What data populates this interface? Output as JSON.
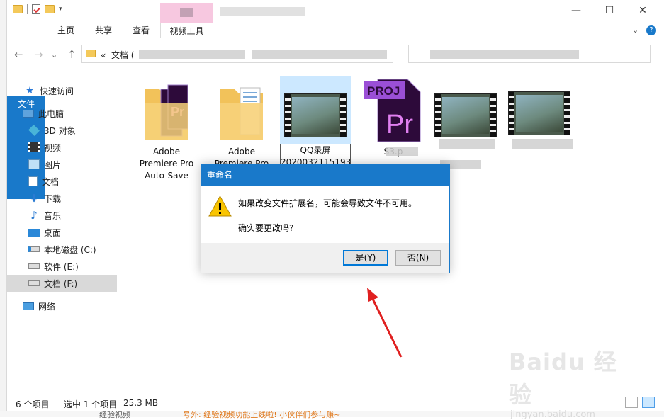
{
  "titlebar": {
    "context_tab_color": "#f7c8e0",
    "min_icon": "minimize-icon",
    "max_icon": "maximize-icon",
    "close_icon": "close-icon"
  },
  "ribbon": {
    "tabs": [
      "文件",
      "主页",
      "共享",
      "查看",
      "视频工具"
    ],
    "accent": "#1979ca"
  },
  "address": {
    "prefix": "«",
    "crumb": "文档 ("
  },
  "navpane": {
    "items": [
      {
        "label": "快速访问",
        "icon": "star-icon"
      },
      {
        "label": "此电脑",
        "icon": "computer-icon"
      },
      {
        "label": "3D 对象",
        "icon": "cube-icon"
      },
      {
        "label": "视频",
        "icon": "film-icon"
      },
      {
        "label": "图片",
        "icon": "picture-icon"
      },
      {
        "label": "文档",
        "icon": "document-icon"
      },
      {
        "label": "下载",
        "icon": "download-icon"
      },
      {
        "label": "音乐",
        "icon": "music-icon"
      },
      {
        "label": "桌面",
        "icon": "desktop-icon"
      },
      {
        "label": "本地磁盘 (C:)",
        "icon": "drive-icon"
      },
      {
        "label": "软件 (E:)",
        "icon": "drive-icon"
      },
      {
        "label": "文档 (F:)",
        "icon": "drive-icon"
      },
      {
        "label": "网络",
        "icon": "network-icon"
      }
    ]
  },
  "files": [
    {
      "name_line1": "Adobe",
      "name_line2": "Premiere Pro",
      "name_line3": "Auto-Save",
      "icon": "pr-folder-icon"
    },
    {
      "name_line1": "Adobe",
      "name_line2": "Premiere Pro",
      "icon": "folder-icon"
    },
    {
      "name_line1": "QQ录屏",
      "name_line2": "20200321151932",
      "icon": "video-thumbnail-icon"
    },
    {
      "name_line1": "S3.p",
      "icon": "prproj-icon",
      "badge": "PROJ",
      "logo": "Pr"
    },
    {
      "icon": "video-thumbnail-icon"
    },
    {
      "icon": "video-thumbnail-icon"
    }
  ],
  "status": {
    "count": "6 个项目",
    "selection": "选中 1 个项目",
    "size": "25.3 MB"
  },
  "dialog": {
    "title": "重命名",
    "message": "如果改变文件扩展名，可能会导致文件不可用。",
    "question": "确实要更改吗?",
    "yes": "是(Y)",
    "no": "否(N)",
    "warn_icon": "warning-icon"
  },
  "watermark": {
    "brand": "Baidu 经验",
    "url": "jingyan.baidu.com"
  },
  "background": {
    "bottom_text1": "经验视频",
    "bottom_text2": "号外: 经验视频功能上线啦! 小伙伴们参与赚~"
  }
}
